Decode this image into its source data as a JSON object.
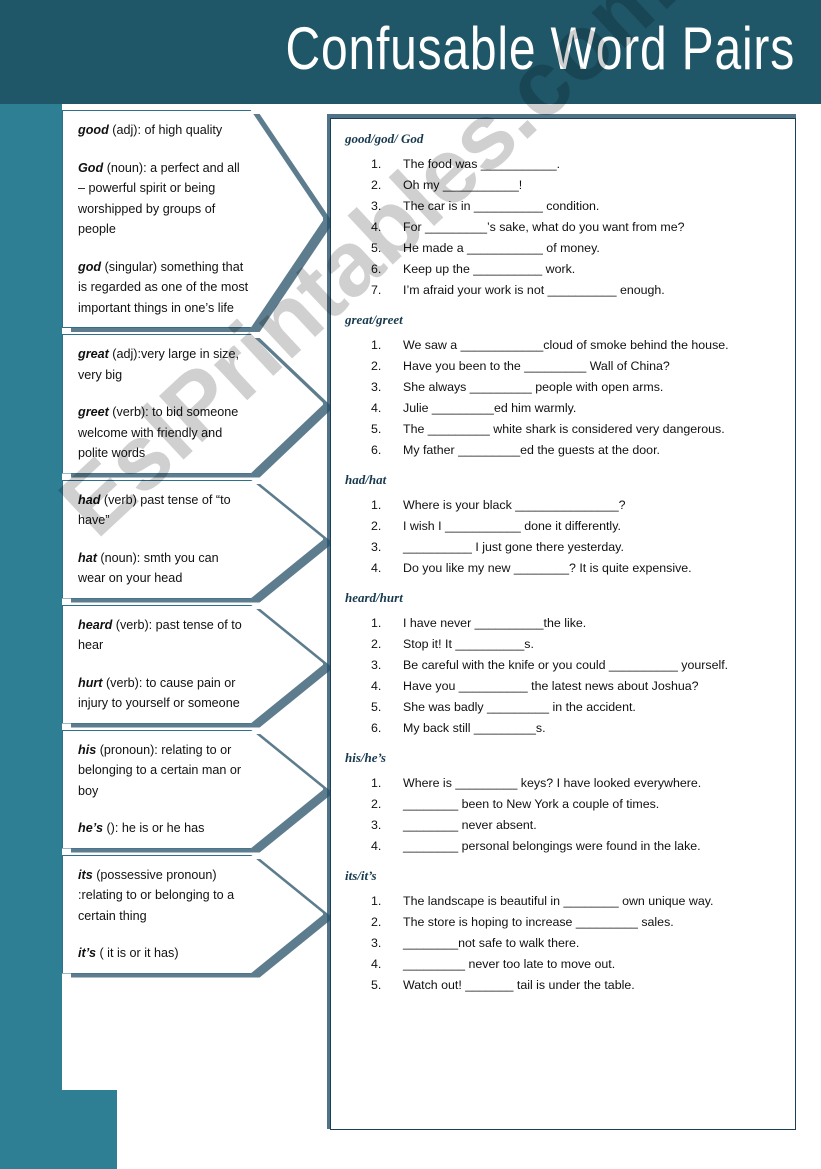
{
  "header": {
    "title": "Confusable Word Pairs"
  },
  "watermark": {
    "text": "EslPrintables.com"
  },
  "colors": {
    "header_band": "#1f5668",
    "left_stripe": "#2e7f94",
    "callout_border": "#2e6f8e",
    "callout_shadow": "#1f4a61",
    "panel_border": "#1b3f55",
    "heading_text": "#16394e",
    "body_text": "#111111",
    "title_text": "#ffffff"
  },
  "definitions": [
    {
      "id": "good-god",
      "entries": [
        {
          "word": "good",
          "text": "(adj): of high quality"
        },
        {
          "word": "God",
          "text": "(noun): a perfect and all – powerful spirit or being worshipped by groups of people"
        },
        {
          "word": "god",
          "text": "(singular) something that is regarded as one of the most important things in one’s life"
        }
      ]
    },
    {
      "id": "great-greet",
      "entries": [
        {
          "word": "great",
          "text": "(adj):very large in size, very big"
        },
        {
          "word": "greet",
          "text": "(verb): to bid someone welcome with friendly and polite words"
        }
      ]
    },
    {
      "id": "had-hat",
      "entries": [
        {
          "word": "had",
          "text": "(verb) past tense of “to have”"
        },
        {
          "word": "hat",
          "text": "(noun): smth you can wear on your head"
        }
      ]
    },
    {
      "id": "heard-hurt",
      "entries": [
        {
          "word": "heard",
          "text": "(verb): past tense of to hear"
        },
        {
          "word": "hurt",
          "text": "(verb): to cause pain or injury to yourself or someone"
        }
      ]
    },
    {
      "id": "his-hes",
      "entries": [
        {
          "word": "his",
          "text": "(pronoun): relating to or belonging to a certain man or boy"
        },
        {
          "word": "he’s",
          "text": "(): he is or he has"
        }
      ]
    },
    {
      "id": "its-its",
      "entries": [
        {
          "word": "its",
          "text": "(possessive pronoun) :relating to or belonging to a certain thing"
        },
        {
          "word": "it’s",
          "text": "( it is or it has)"
        }
      ]
    }
  ],
  "exercises": [
    {
      "id": "good-god-God",
      "heading": "good/god/ God",
      "items": [
        {
          "n": "1.",
          "text": "The food was ___________."
        },
        {
          "n": "2.",
          "text": "Oh my ___________!"
        },
        {
          "n": "3.",
          "text": "The car is in __________ condition."
        },
        {
          "n": "4.",
          "text": "For _________’s sake, what do you want from me?"
        },
        {
          "n": "5.",
          "text": "He made a ___________ of money."
        },
        {
          "n": "6.",
          "text": "Keep up the __________ work."
        },
        {
          "n": "7.",
          "text": "I’m afraid your work is not __________ enough."
        }
      ]
    },
    {
      "id": "great-greet",
      "heading": "great/greet",
      "items": [
        {
          "n": "1.",
          "text": "We saw a ____________cloud of smoke behind the house."
        },
        {
          "n": "2.",
          "text": "Have you been to the _________ Wall of China?"
        },
        {
          "n": "3.",
          "text": "She always _________ people with open arms."
        },
        {
          "n": "4.",
          "text": "Julie _________ed him warmly."
        },
        {
          "n": "5.",
          "text": "The _________ white shark is considered very dangerous."
        },
        {
          "n": "6.",
          "text": "My father _________ed the guests at the door."
        }
      ]
    },
    {
      "id": "had-hat",
      "heading": "had/hat",
      "items": [
        {
          "n": "1.",
          "text": "Where is your black _______________?"
        },
        {
          "n": "2.",
          "text": "I wish I ___________ done it differently."
        },
        {
          "n": "3.",
          "text": "__________ I just gone there yesterday."
        },
        {
          "n": "4.",
          "text": "Do you like my new ________? It is quite expensive."
        }
      ]
    },
    {
      "id": "heard-hurt",
      "heading": "heard/hurt",
      "items": [
        {
          "n": "1.",
          "text": "I have never __________the like."
        },
        {
          "n": "2.",
          "text": "Stop it! It __________s."
        },
        {
          "n": "3.",
          "text": "Be careful with the knife or you could __________ yourself."
        },
        {
          "n": "4.",
          "text": "Have you __________ the latest news about Joshua?"
        },
        {
          "n": "5.",
          "text": "She was badly _________ in the accident."
        },
        {
          "n": "6.",
          "text": "My back still _________s."
        }
      ]
    },
    {
      "id": "his-hes",
      "heading": "his/he’s",
      "items": [
        {
          "n": "1.",
          "text": "Where is _________ keys? I have looked everywhere."
        },
        {
          "n": "2.",
          "text": "________ been to New York a couple of times."
        },
        {
          "n": "3.",
          "text": "________ never absent."
        },
        {
          "n": "4.",
          "text": "________ personal belongings were found in the lake."
        }
      ]
    },
    {
      "id": "its-its",
      "heading": "its/it’s",
      "items": [
        {
          "n": "1.",
          "text": "The landscape is beautiful in ________ own unique way."
        },
        {
          "n": "2.",
          "text": "The store is hoping to increase _________ sales."
        },
        {
          "n": "3.",
          "text": "________not safe to walk there."
        },
        {
          "n": "4.",
          "text": "_________ never too late to move out."
        },
        {
          "n": "5.",
          "text": "Watch out! _______ tail is under the table."
        }
      ]
    }
  ]
}
